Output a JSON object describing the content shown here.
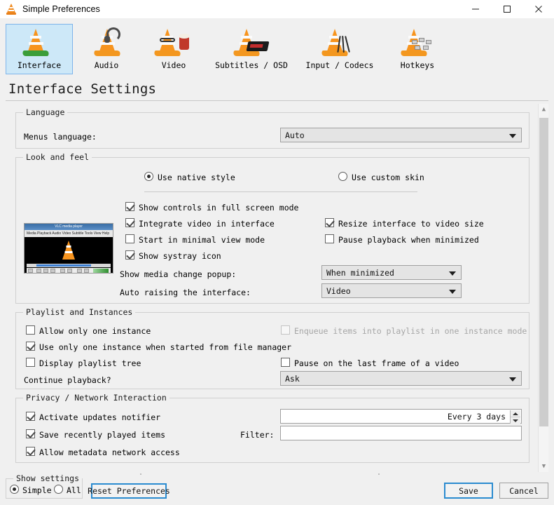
{
  "window": {
    "title": "Simple Preferences",
    "icon": "vlc-cone-icon",
    "controls": {
      "minimize": "minimize-icon",
      "maximize": "maximize-icon",
      "close": "close-icon"
    }
  },
  "toolbar": {
    "items": [
      {
        "label": "Interface",
        "icon": "vlc-cone-interface-icon",
        "selected": true
      },
      {
        "label": "Audio",
        "icon": "vlc-cone-headphones-icon",
        "selected": false
      },
      {
        "label": "Video",
        "icon": "vlc-cone-glasses-popcorn-icon",
        "selected": false
      },
      {
        "label": "Subtitles / OSD",
        "icon": "vlc-cone-osd-icon",
        "selected": false
      },
      {
        "label": "Input / Codecs",
        "icon": "vlc-cone-cables-icon",
        "selected": false
      },
      {
        "label": "Hotkeys",
        "icon": "vlc-cone-keys-icon",
        "selected": false
      }
    ]
  },
  "page": {
    "title": "Interface Settings"
  },
  "language_group": {
    "legend": "Language",
    "menus_language_label": "Menus language:",
    "menus_language_value": "Auto"
  },
  "look_and_feel": {
    "legend": "Look and feel",
    "style_radio": [
      {
        "label": "Use native style",
        "checked": true
      },
      {
        "label": "Use custom skin",
        "checked": false
      }
    ],
    "checkboxes_left": [
      {
        "label": "Show controls in full screen mode",
        "checked": true,
        "enabled": true
      },
      {
        "label": "Integrate video in interface",
        "checked": true,
        "enabled": true
      },
      {
        "label": "Start in minimal view mode",
        "checked": false,
        "enabled": true
      },
      {
        "label": "Show systray icon",
        "checked": true,
        "enabled": true
      }
    ],
    "checkboxes_right": [
      {
        "label": "Resize interface to video size",
        "checked": true,
        "enabled": true
      },
      {
        "label": "Pause playback when minimized",
        "checked": false,
        "enabled": true
      }
    ],
    "media_popup_label": "Show media change popup:",
    "media_popup_value": "When minimized",
    "auto_raise_label": "Auto raising the interface:",
    "auto_raise_value": "Video",
    "preview": {
      "window_title": "VLC media player",
      "menu": "Media Playback Audio Video Subtitle Tools View Help",
      "time_left": "00:00",
      "time_right": "00:00"
    }
  },
  "playlist_group": {
    "legend": "Playlist and Instances",
    "checkboxes_left": [
      {
        "label": "Allow only one instance",
        "checked": false,
        "enabled": true
      },
      {
        "label": "Use only one instance when started from file manager",
        "checked": true,
        "enabled": true
      },
      {
        "label": "Display playlist tree",
        "checked": false,
        "enabled": true
      }
    ],
    "checkboxes_right": [
      {
        "label": "Enqueue items into playlist in one instance mode",
        "checked": false,
        "enabled": false
      },
      {
        "label": "Pause on the last frame of a video",
        "checked": false,
        "enabled": true
      }
    ],
    "continue_label": "Continue playback?",
    "continue_value": "Ask"
  },
  "privacy_group": {
    "legend": "Privacy / Network Interaction",
    "checkboxes": [
      {
        "label": "Activate updates notifier",
        "checked": true,
        "enabled": true
      },
      {
        "label": "Save recently played items",
        "checked": true,
        "enabled": true
      },
      {
        "label": "Allow metadata network access",
        "checked": true,
        "enabled": true
      }
    ],
    "updates_interval_value": "Every 3 days",
    "filter_label": "Filter:",
    "filter_value": ""
  },
  "bottom": {
    "show_settings_legend": "Show settings",
    "show_settings_options": [
      {
        "label": "Simple",
        "checked": true
      },
      {
        "label": "All",
        "checked": false
      }
    ],
    "reset_button": "Reset Preferences",
    "save_button": "Save",
    "cancel_button": "Cancel"
  },
  "colors": {
    "accent_selected": "#cde8f8",
    "accent_border": "#7eb4ea",
    "focus_blue": "#2a8bd0",
    "window_bg": "#f0f0f0",
    "vlc_orange": "#f7941e"
  }
}
